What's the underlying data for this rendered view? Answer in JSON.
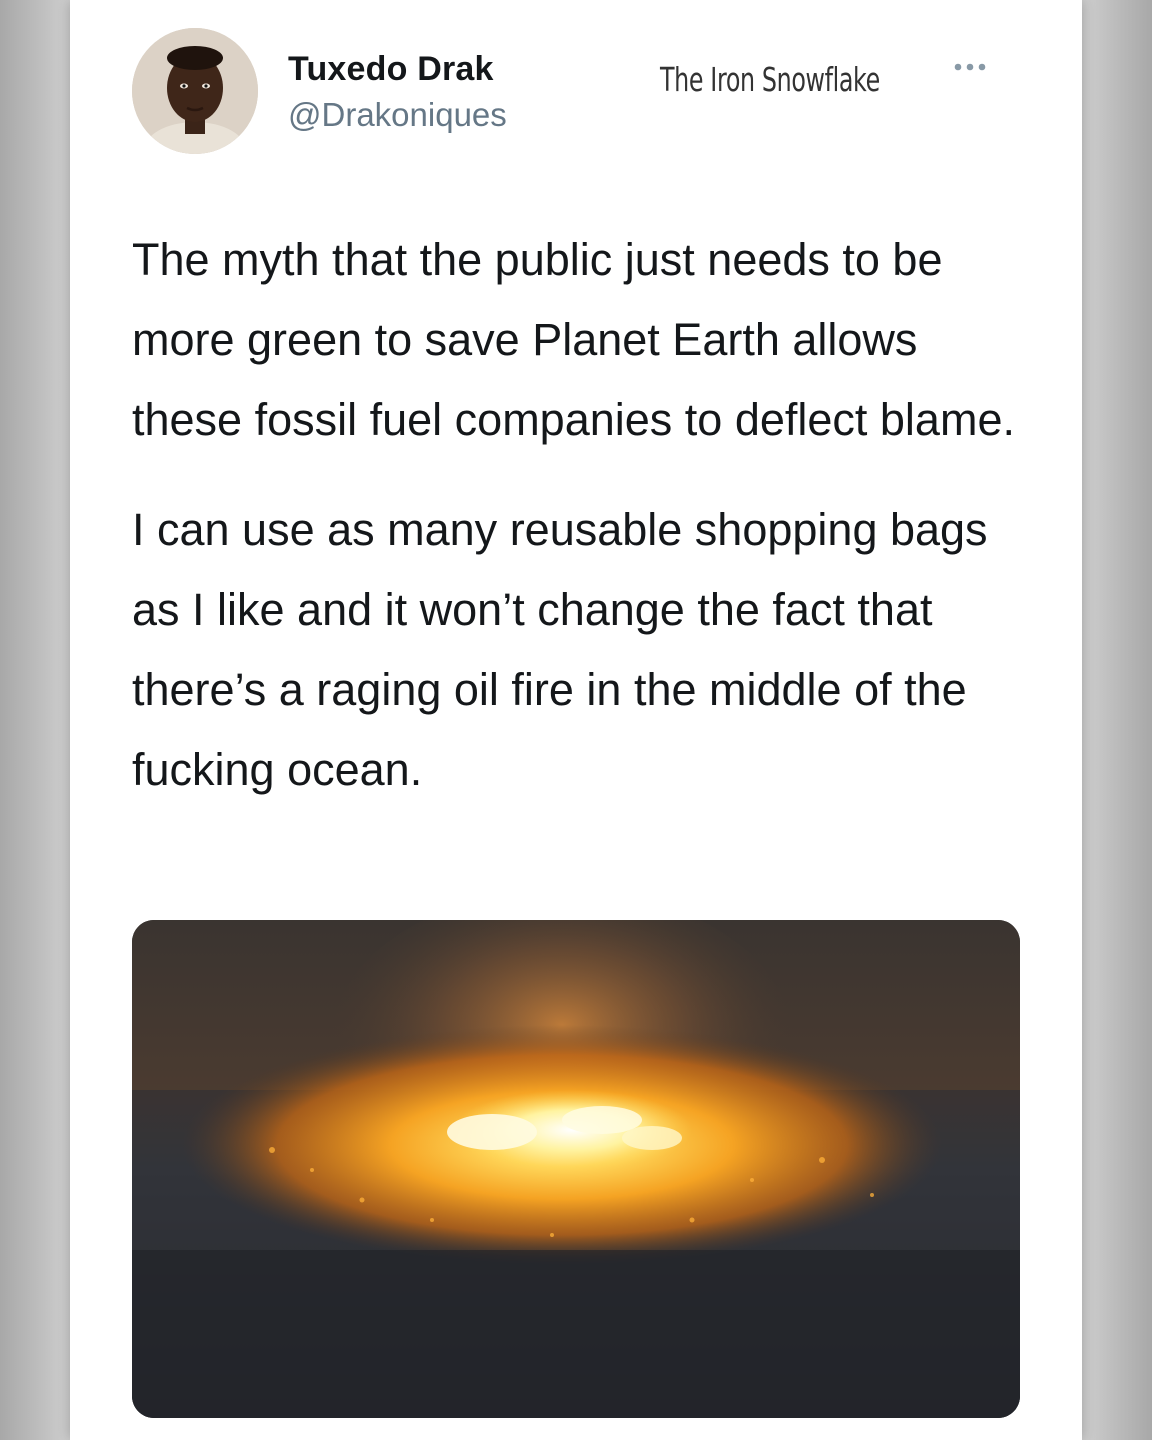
{
  "tweet": {
    "author": {
      "display_name": "Tuxedo Drak",
      "handle": "@Drakoniques",
      "avatar_icon": "person-avatar"
    },
    "watermark": "The Iron Snowflake",
    "more_icon": "ellipsis-icon",
    "paragraphs": [
      "The myth that the public just needs to be more green to save Planet Earth allows these fossil fuel companies to deflect blame.",
      "I can use as many reusable shopping bags as I like and it won’t change the fact that there’s a raging oil fire in the middle of the fucking ocean."
    ],
    "media": {
      "description_icon": "ocean-fire-photo"
    }
  },
  "colors": {
    "text": "#14171a",
    "secondary_text": "#657786",
    "card_background": "#ffffff",
    "page_background": "#b9b9b9",
    "fire_core": "#fff4a8",
    "fire_orange": "#f39a1c",
    "ocean_dark": "#2a2d33"
  }
}
